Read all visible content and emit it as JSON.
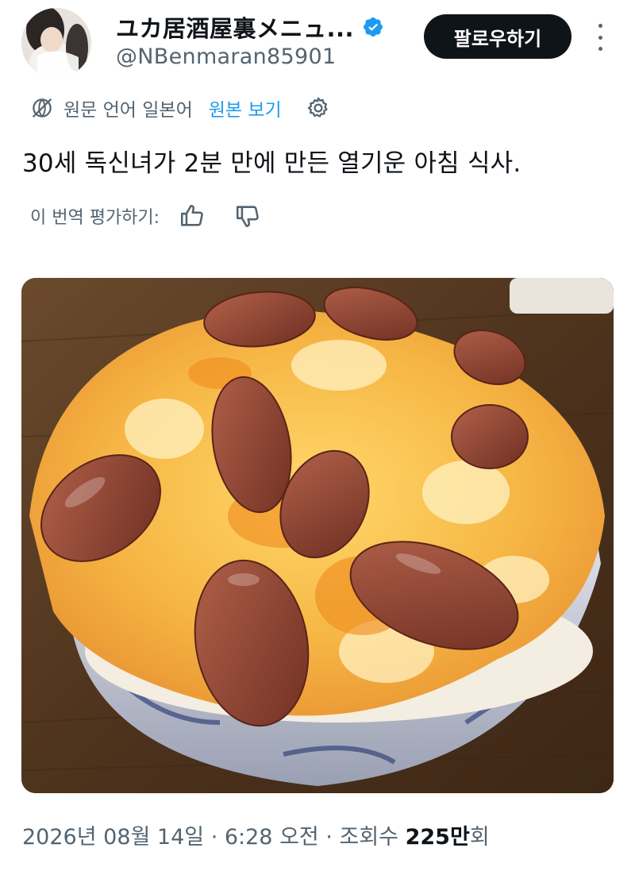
{
  "author": {
    "display_name": "ユカ居酒屋裏メニュ...",
    "handle": "@NBenmaran85901",
    "verified": true
  },
  "actions": {
    "follow_label": "팔로우하기",
    "more_icon": "more-vertical-icon"
  },
  "translation": {
    "note": "원문 언어 일본어",
    "show_original_label": "원본 보기",
    "rate_label": "이 번역 평가하기:"
  },
  "tweet": {
    "text": "30세 독신녀가 2분 만에 만든 열기운 아침 식사."
  },
  "media": {
    "photo_icon": "photo"
  },
  "meta": {
    "date": "2026년 08월 14일 · 6:28 오전 · 조회수 ",
    "views_number": "225만",
    "views_suffix": "회"
  },
  "colors": {
    "text": "#0f1419",
    "secondary": "#536471",
    "link": "#1d9bf0",
    "verified": "#1d9bf0",
    "follow_bg": "#0f1419"
  }
}
